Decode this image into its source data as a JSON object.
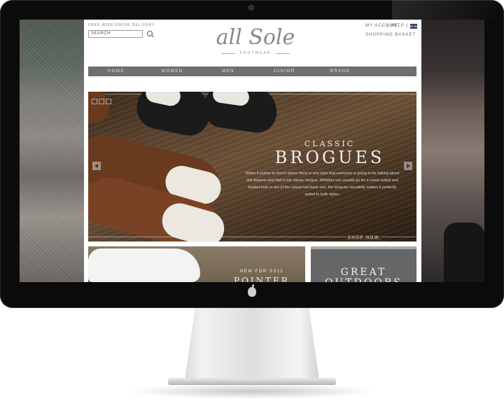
{
  "header": {
    "free_delivery": "FREE WORLDWIDE DELIVERY",
    "search_placeholder": "SEARCH",
    "my_account": "MY ACCOUNT",
    "help": "| HELP |",
    "shopping_basket": "SHOPPING BASKET"
  },
  "logo": {
    "name": "all Sole",
    "sub": "FOOTWEAR"
  },
  "nav": {
    "items": [
      "HOME",
      "WOMEN",
      "MEN",
      "JUNIOR",
      "BRAND"
    ]
  },
  "hero": {
    "kicker": "CLASSIC",
    "title": "BROGUES",
    "body": "When it comes to men's shoes there is one style that everyone is going to be talking about this Autumn and that is the classic brogue. Whether you usually go for a smart suited and booted look or are of the casual laid back sort, the brogues versatility makes it perfectly suited to both styles.",
    "cta": "SHOP NOW"
  },
  "promos": [
    {
      "kicker": "NEW FOR SS11",
      "title": "POINTER"
    },
    {
      "title": "GREAT OUTDOORS"
    }
  ],
  "colors": {
    "nav_bg": "#6f6f6f",
    "logo": "#888888",
    "bezel": "#0b0b0b"
  },
  "icons": [
    "search-icon",
    "uk-flag-icon",
    "arrow-left-icon",
    "arrow-right-icon",
    "apple-logo-icon"
  ]
}
